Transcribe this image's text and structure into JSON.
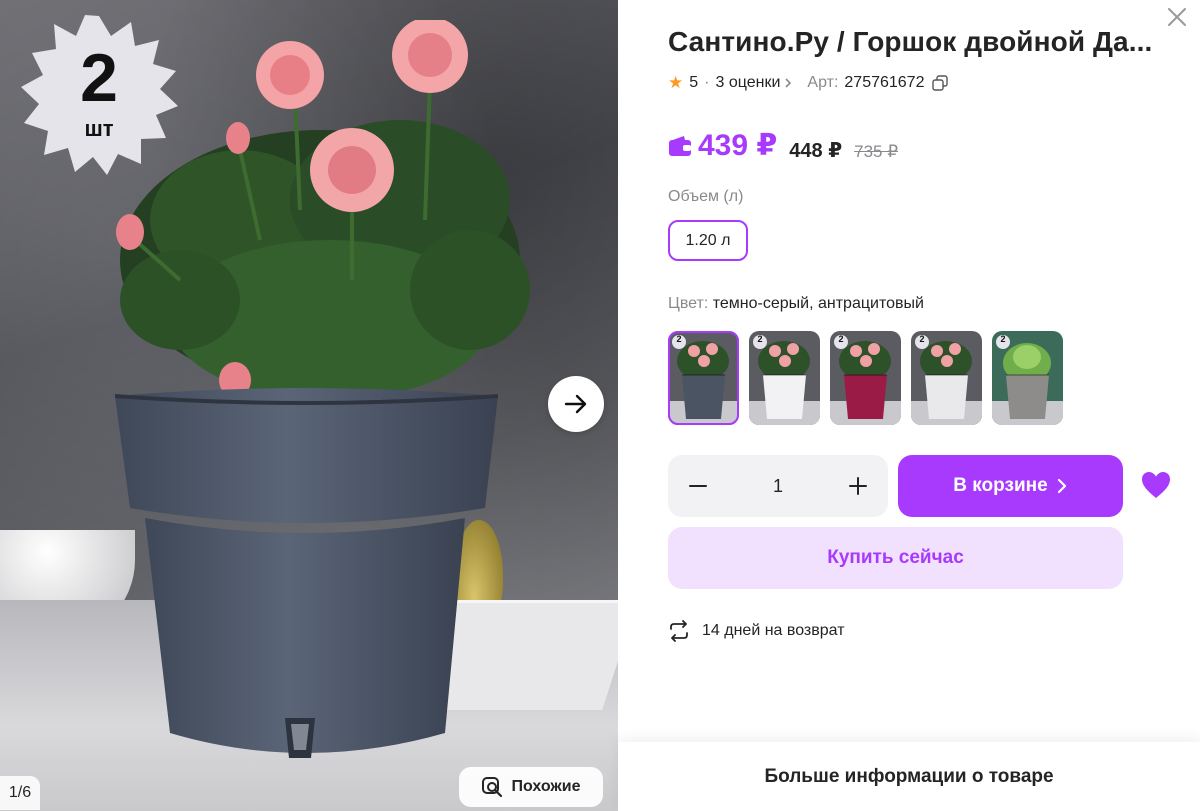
{
  "gallery": {
    "badge_number": "2",
    "badge_unit": "шт",
    "counter": "1/6",
    "similar_label": "Похожие"
  },
  "product": {
    "title": "Сантино.Ру / Горшок двойной Да...",
    "rating": "5",
    "reviews": "3 оценки",
    "article_label": "Арт:",
    "article": "275761672"
  },
  "price": {
    "wallet_price": "439 ₽",
    "price": "448 ₽",
    "old_price": "735 ₽",
    "accent_color": "#a73afd"
  },
  "volume": {
    "label": "Объем (л)",
    "selected": "1.20 л"
  },
  "color": {
    "label": "Цвет:",
    "value": "темно-серый, антрацитовый",
    "swatches": [
      {
        "name": "anthracite",
        "pot_color": "#4a5463",
        "badge": "2"
      },
      {
        "name": "white",
        "pot_color": "#f2f2f4",
        "badge": "2"
      },
      {
        "name": "crimson",
        "pot_color": "#9b1b47",
        "badge": "2"
      },
      {
        "name": "light-grey",
        "pot_color": "#e9e9ec",
        "badge": "2"
      },
      {
        "name": "grey",
        "pot_color": "#8d8c8a",
        "badge": "2"
      }
    ]
  },
  "quantity": "1",
  "actions": {
    "cart_label": "В корзине",
    "buy_now_label": "Купить сейчас"
  },
  "returns": "14 дней на возврат",
  "more_info": "Больше информации о товаре"
}
